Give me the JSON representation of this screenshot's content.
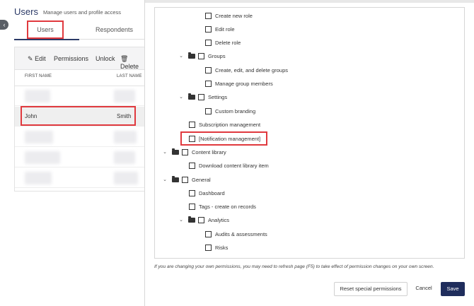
{
  "left": {
    "title": "Users",
    "subtitle": "Manage users and profile access",
    "tabs": [
      {
        "label": "Users"
      },
      {
        "label": "Respondents"
      }
    ],
    "toolbar": {
      "edit": "Edit",
      "permissions": "Permissions",
      "unlock": "Unlock",
      "delete": "Delete"
    },
    "columns": {
      "first": "FIRST NAME",
      "last": "LAST NAME"
    },
    "selected_row": {
      "first": "John",
      "last": "Smith"
    }
  },
  "modal": {
    "tree": {
      "create_new_role": "Create new role",
      "edit_role": "Edit role",
      "delete_role": "Delete role",
      "groups": "Groups",
      "create_edit_delete_groups": "Create, edit, and delete groups",
      "manage_group_members": "Manage group members",
      "settings": "Settings",
      "custom_branding": "Custom branding",
      "subscription_management": "Subscription management",
      "notification_management": "[Notification management]",
      "content_library": "Content library",
      "download_content_library_item": "Download content library item",
      "general": "General",
      "dashboard": "Dashboard",
      "tags_create_on_records": "Tags - create on records",
      "analytics": "Analytics",
      "audits_assessments": "Audits & assessments",
      "risks": "Risks"
    },
    "note": "If you are changing your own permissions, you may need to refresh page (F5) to take effect of permission changes on your own screen.",
    "buttons": {
      "reset": "Reset special permissions",
      "cancel": "Cancel",
      "save": "Save"
    }
  },
  "colors": {
    "accent": "#2b3a67",
    "save_bg": "#1f2d5c",
    "highlight": "#e0393e"
  }
}
